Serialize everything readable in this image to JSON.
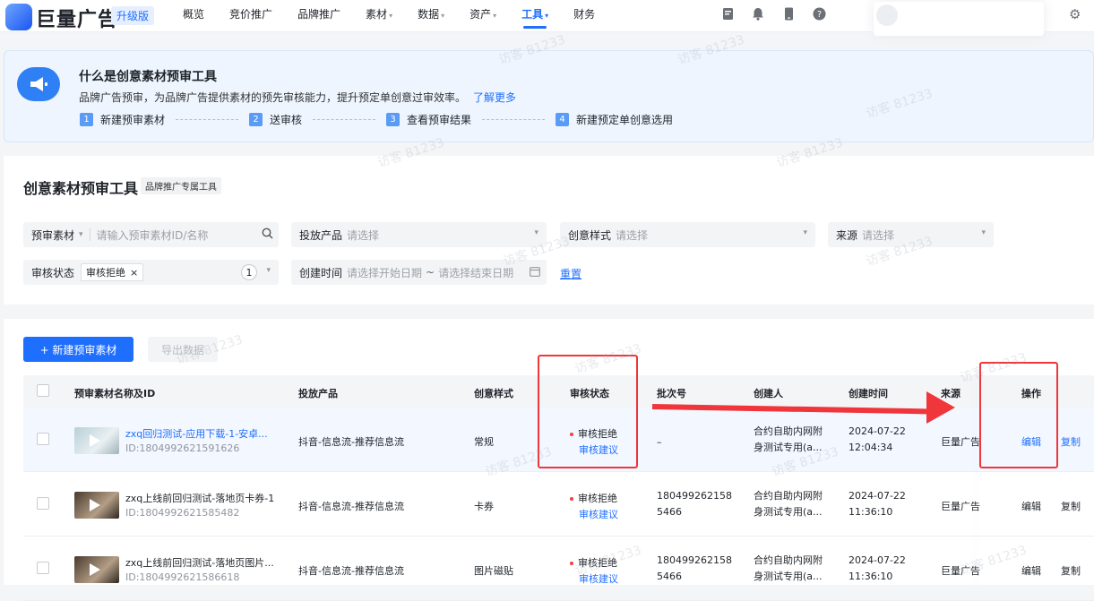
{
  "brand": {
    "name": "巨量广告",
    "badge": "升级版"
  },
  "nav": [
    {
      "label": "概览",
      "caret": ""
    },
    {
      "label": "竞价推广",
      "caret": ""
    },
    {
      "label": "品牌推广",
      "caret": ""
    },
    {
      "label": "素材",
      "caret": "▾"
    },
    {
      "label": "数据",
      "caret": "▾"
    },
    {
      "label": "资产",
      "caret": "▾"
    },
    {
      "label": "工具",
      "caret": "▾",
      "active": true
    },
    {
      "label": "财务",
      "caret": ""
    }
  ],
  "top_icons": [
    "book-icon",
    "bell-icon",
    "phone-icon",
    "help-icon"
  ],
  "banner": {
    "title": "什么是创意素材预审工具",
    "desc": "品牌广告预审，为品牌广告提供素材的预先审核能力，提升预定单创意过审效率。",
    "link": "了解更多",
    "steps": [
      {
        "num": "1",
        "label": "新建预审素材"
      },
      {
        "num": "2",
        "label": "送审核"
      },
      {
        "num": "3",
        "label": "查看预审结果"
      },
      {
        "num": "4",
        "label": "新建预定单创意选用"
      }
    ]
  },
  "page": {
    "title": "创意素材预审工具",
    "tag": "品牌推广专属工具"
  },
  "filters": {
    "material_type": "预审素材",
    "material_placeholder": "请输入预审素材ID/名称",
    "product_label": "投放产品",
    "product_placeholder": "请选择",
    "style_label": "创意样式",
    "style_placeholder": "请选择",
    "source_label": "来源",
    "source_placeholder": "请选择",
    "status_label": "审核状态",
    "status_chip": "审核拒绝",
    "status_count": "1",
    "time_label": "创建时间",
    "time_start": "请选择开始日期",
    "time_sep": "~",
    "time_end": "请选择结束日期",
    "reset": "重置"
  },
  "actions": {
    "new": "+ 新建预审素材",
    "export": "导出数据"
  },
  "table": {
    "headers": [
      "预审素材名称及ID",
      "投放产品",
      "创意样式",
      "审核状态",
      "批次号",
      "创建人",
      "创建时间",
      "来源",
      "操作"
    ],
    "rows": [
      {
        "name": "zxq回归测试-应用下载-1-安卓...",
        "id": "ID:1804992621591626",
        "product": "抖音-信息流-推荐信息流",
        "style": "常规",
        "status": "审核拒绝",
        "suggest": "审核建议",
        "batch1": "–",
        "batch2": "",
        "creator1": "合约自助内网附",
        "creator2": "身测试专用(a...",
        "date": "2024-07-22",
        "time": "12:04:34",
        "source": "巨量广告",
        "edit": "编辑",
        "copy": "复制"
      },
      {
        "name": "zxq上线前回归测试-落地页卡券-1",
        "id": "ID:1804992621585482",
        "product": "抖音-信息流-推荐信息流",
        "style": "卡券",
        "status": "审核拒绝",
        "suggest": "审核建议",
        "batch1": "180499262158",
        "batch2": "5466",
        "creator1": "合约自助内网附",
        "creator2": "身测试专用(a...",
        "date": "2024-07-22",
        "time": "11:36:10",
        "source": "巨量广告",
        "edit": "编辑",
        "copy": "复制"
      },
      {
        "name": "zxq上线前回归测试-落地页图片...",
        "id": "ID:1804992621586618",
        "product": "抖音-信息流-推荐信息流",
        "style": "图片磁贴",
        "status": "审核拒绝",
        "suggest": "审核建议",
        "batch1": "180499262158",
        "batch2": "5466",
        "creator1": "合约自助内网附",
        "creator2": "身测试专用(a...",
        "date": "2024-07-22",
        "time": "11:36:10",
        "source": "巨量广告",
        "edit": "编辑",
        "copy": "复制"
      }
    ]
  },
  "watermark": "访客 81233",
  "colors": {
    "primary": "#1f6fff",
    "reject": "#f53f3f",
    "annotation": "#f0353b"
  }
}
